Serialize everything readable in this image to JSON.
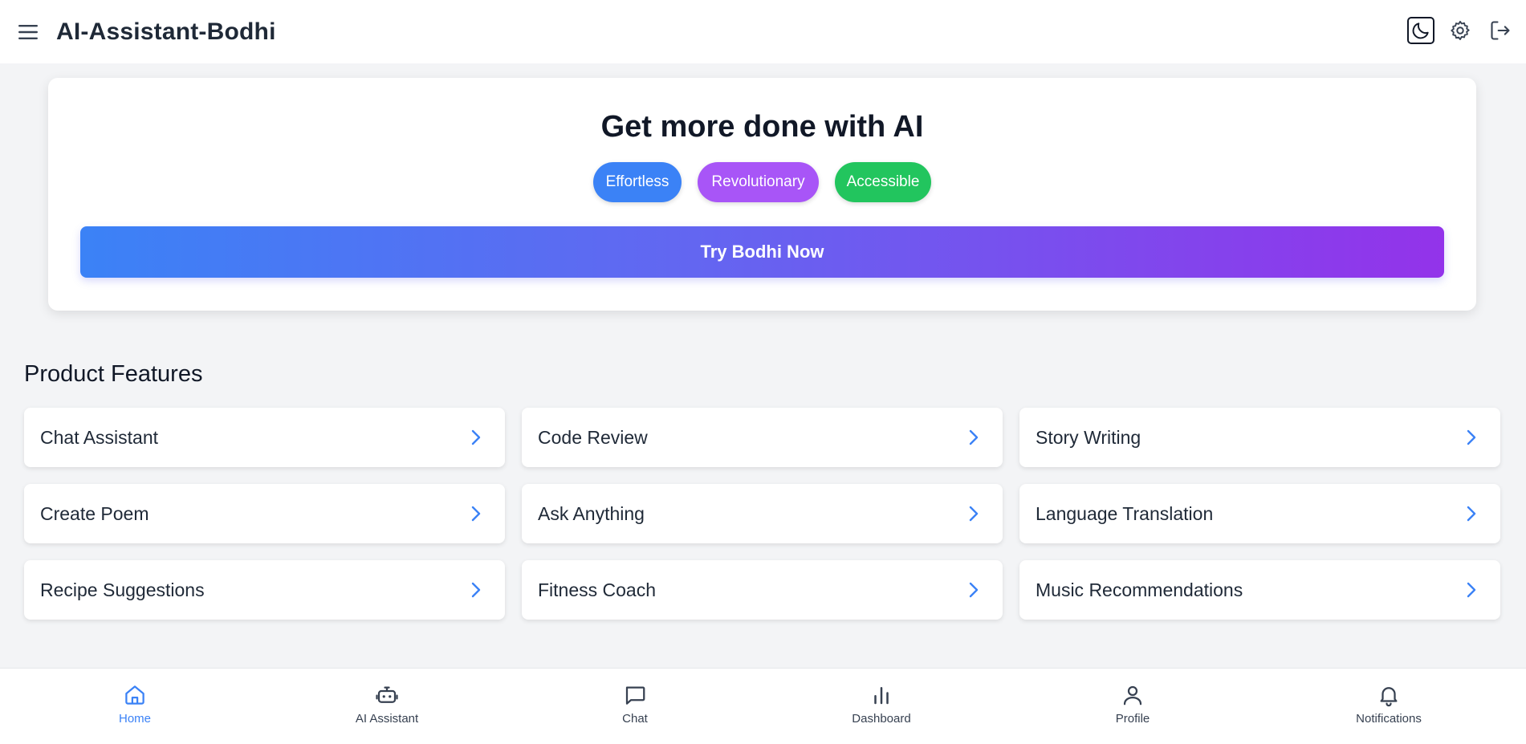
{
  "header": {
    "title": "AI-Assistant-Bodhi",
    "menu_icon": "menu-icon",
    "actions": [
      {
        "name": "theme-toggle",
        "icon": "moon-icon"
      },
      {
        "name": "settings",
        "icon": "gear-icon"
      },
      {
        "name": "logout",
        "icon": "logout-icon"
      }
    ]
  },
  "hero": {
    "title": "Get more done with AI",
    "pills": [
      "Effortless",
      "Revolutionary",
      "Accessible"
    ],
    "cta_label": "Try Bodhi Now"
  },
  "features": {
    "title": "Product Features",
    "items": [
      "Chat Assistant",
      "Code Review",
      "Story Writing",
      "Create Poem",
      "Ask Anything",
      "Language Translation",
      "Recipe Suggestions",
      "Fitness Coach",
      "Music Recommendations"
    ]
  },
  "bottom_nav": {
    "items": [
      {
        "label": "Home",
        "icon": "home-icon",
        "active": true
      },
      {
        "label": "AI Assistant",
        "icon": "robot-icon",
        "active": false
      },
      {
        "label": "Chat",
        "icon": "chat-icon",
        "active": false
      },
      {
        "label": "Dashboard",
        "icon": "bar-chart-icon",
        "active": false
      },
      {
        "label": "Profile",
        "icon": "user-icon",
        "active": false
      },
      {
        "label": "Notifications",
        "icon": "bell-icon",
        "active": false
      }
    ]
  },
  "colors": {
    "accent": "#3b82f6",
    "purple": "#a855f7",
    "green": "#22c55e",
    "gradient_end": "#9333ea"
  }
}
